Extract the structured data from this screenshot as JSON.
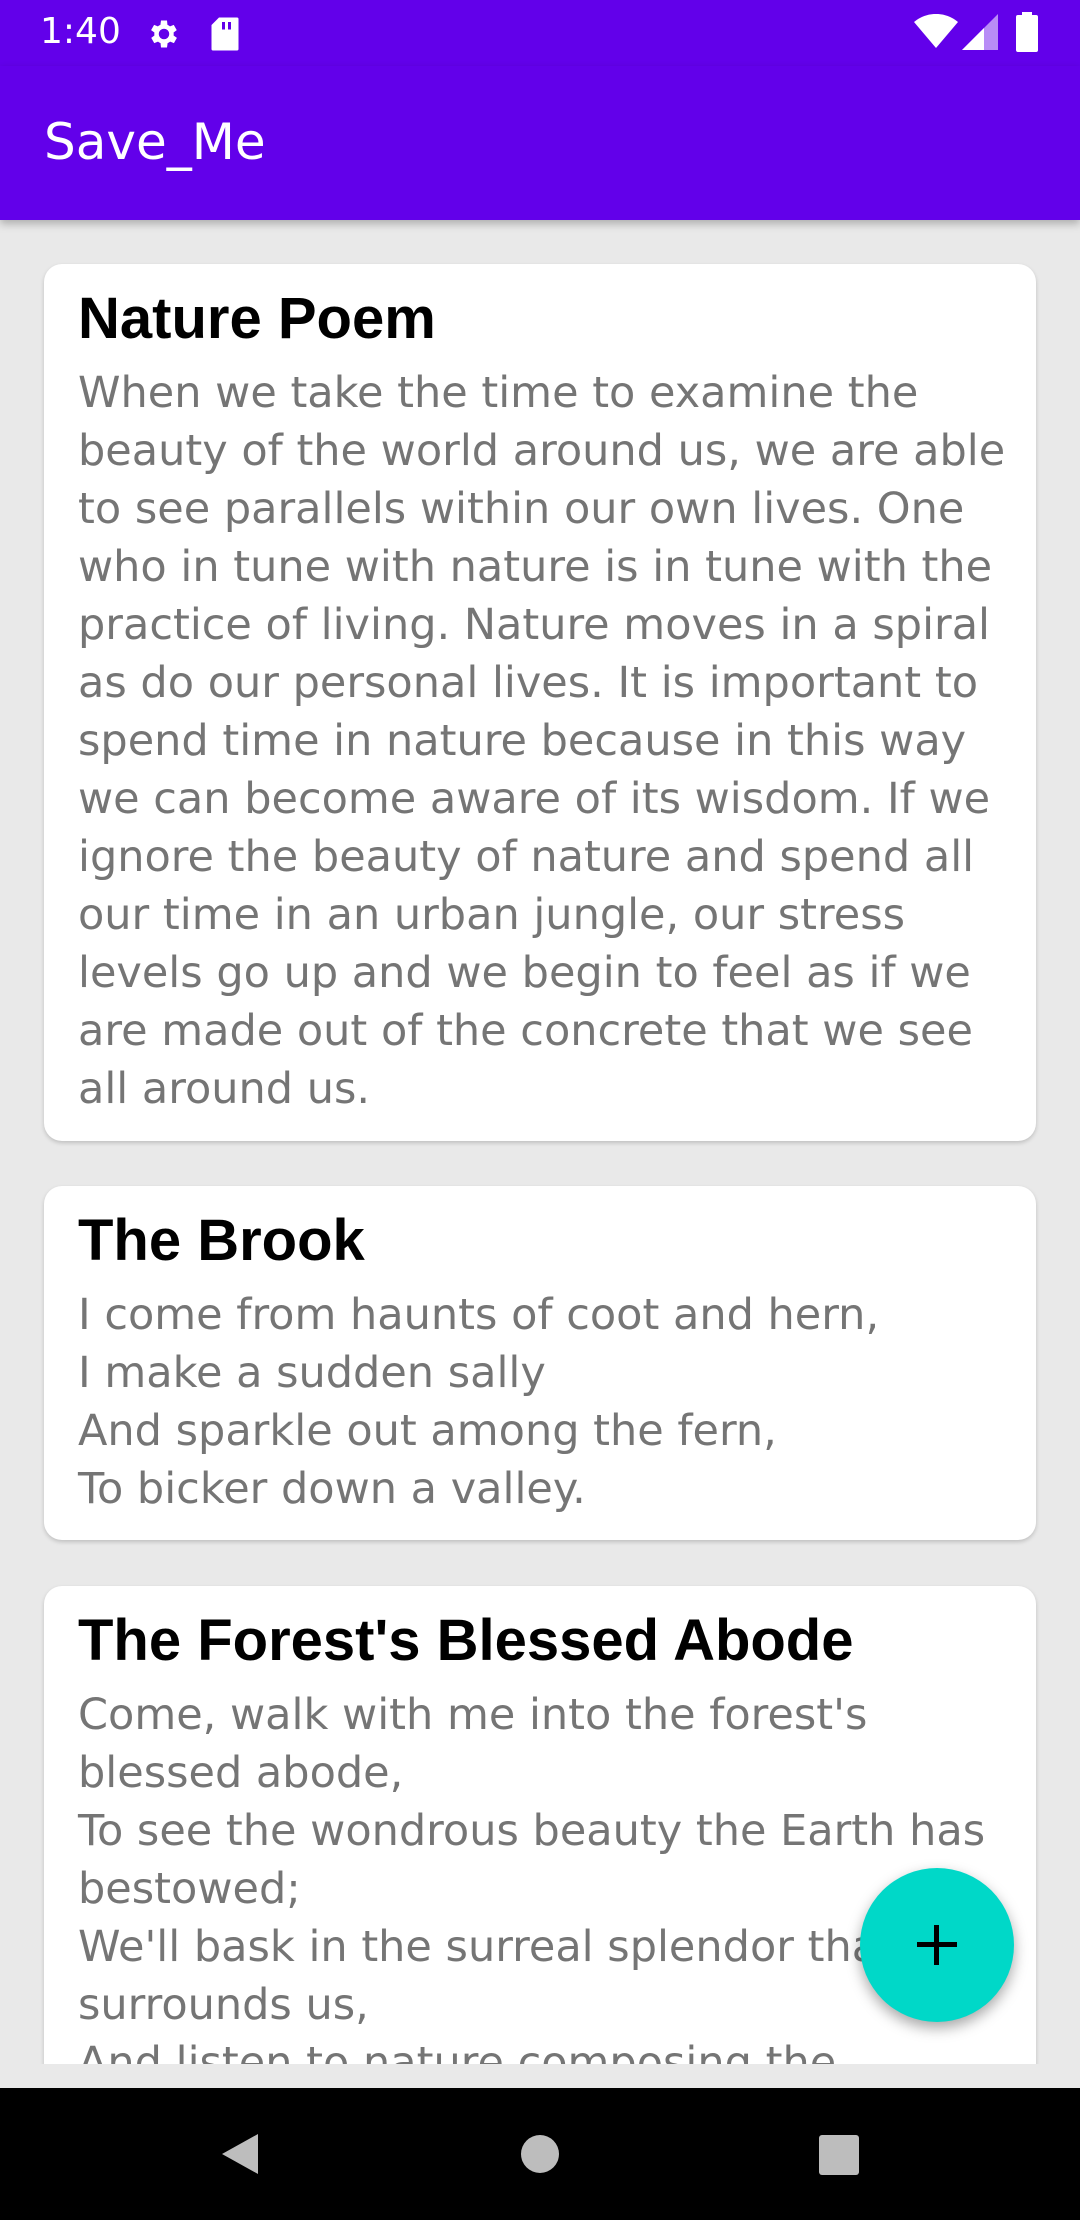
{
  "status_bar": {
    "time": "1:40",
    "icons": [
      "gear-icon",
      "sd-card-icon",
      "wifi-icon",
      "signal-icon",
      "battery-icon"
    ]
  },
  "app_bar": {
    "title": "Save_Me",
    "color": "#6200EA"
  },
  "notes": [
    {
      "title": "Nature Poem",
      "body": "When we take the time to examine the beauty of the world around us, we are able to see parallels within our own lives. One who in tune with nature is in tune with the practice of living. Nature moves in a spiral as do our personal lives. It is important to spend time in nature because in this way we can become aware of its wisdom. If we ignore the beauty of nature and spend all our time in an urban jungle, our stress levels go up and we begin to feel as if we are made out of the concrete that we see all around us."
    },
    {
      "title": "The Brook",
      "body": "I come from haunts of coot and hern,\nI make a sudden sally\nAnd sparkle out among the fern,\nTo bicker down a valley."
    },
    {
      "title": "The Forest's Blessed Abode",
      "body": "Come, walk with me into the forest's blessed abode,\nTo see the wondrous beauty the Earth has bestowed;\nWe'll bask in the surreal splendor that surrounds us,\nAnd listen to nature composing the"
    }
  ],
  "fab": {
    "icon": "plus-icon",
    "color": "#00D8C8"
  },
  "nav_bar": {
    "icons": [
      "back-icon",
      "home-icon",
      "recents-icon"
    ]
  }
}
